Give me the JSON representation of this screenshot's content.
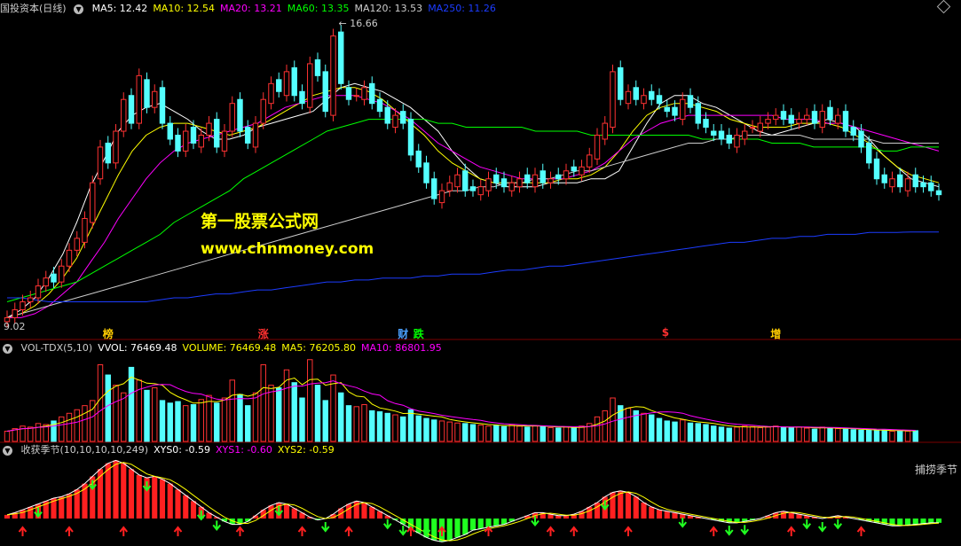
{
  "header": {
    "stock_name": "国投资本(日线)",
    "ma_labels": [
      {
        "text": "MA5: 12.42",
        "color": "#ffffff"
      },
      {
        "text": "MA10: 12.54",
        "color": "#ffff00"
      },
      {
        "text": "MA20: 13.21",
        "color": "#ff00ff"
      },
      {
        "text": "MA60: 13.35",
        "color": "#00ff00"
      },
      {
        "text": "MA120: 13.53",
        "color": "#cccccc"
      },
      {
        "text": "MA250: 11.26",
        "color": "#1c3cff"
      }
    ]
  },
  "vol_header": {
    "labels": [
      {
        "text": "VOL-TDX(5,10)",
        "color": "#cccccc"
      },
      {
        "text": "VVOL: 76469.48",
        "color": "#ffffff"
      },
      {
        "text": "VOLUME: 76469.48",
        "color": "#ffff00"
      },
      {
        "text": "MA5: 76205.80",
        "color": "#ffff00"
      },
      {
        "text": "MA10: 86801.95",
        "color": "#ff00ff"
      }
    ]
  },
  "ind_header": {
    "labels": [
      {
        "text": "收获季节(10,10,10,10,249)",
        "color": "#cccccc"
      },
      {
        "text": "XYS0: -0.59",
        "color": "#ffffff"
      },
      {
        "text": "XYS1: -0.60",
        "color": "#ff00ff"
      },
      {
        "text": "XYS2: -0.59",
        "color": "#ffff00"
      }
    ],
    "right_label": "捕捞季节"
  },
  "watermark": {
    "line1": "第一股票公式网",
    "line2": "www.chnmoney.com"
  },
  "events": [
    {
      "text": "榜",
      "color": "#ffcc00",
      "bar": 13
    },
    {
      "text": "涨",
      "color": "#ff3030",
      "bar": 33
    },
    {
      "text": "财",
      "color": "#4aa0ff",
      "bar": 51
    },
    {
      "text": "跌",
      "color": "#00ff00",
      "bar": 53
    },
    {
      "text": "$",
      "color": "#ff3030",
      "bar": 85
    },
    {
      "text": "增",
      "color": "#ffcc00",
      "bar": 99
    }
  ],
  "chart_data": {
    "type": "candlestick",
    "price_ylim": [
      9.02,
      16.66
    ],
    "price_high_label": "16.66",
    "price_low_label": "9.02",
    "closes": [
      9.1,
      9.3,
      9.5,
      9.6,
      9.9,
      10.1,
      10.0,
      10.4,
      10.8,
      11.1,
      11.6,
      12.5,
      13.4,
      13.0,
      13.8,
      14.6,
      14.0,
      15.2,
      14.4,
      14.8,
      14.0,
      13.6,
      13.3,
      13.8,
      13.5,
      13.7,
      14.0,
      13.4,
      13.8,
      14.5,
      13.8,
      13.5,
      14.0,
      14.6,
      15.0,
      14.8,
      15.3,
      14.7,
      14.5,
      15.5,
      15.2,
      14.3,
      16.2,
      15.0,
      14.6,
      14.7,
      14.9,
      14.5,
      14.3,
      14.0,
      14.2,
      14.0,
      13.2,
      12.9,
      12.5,
      12.1,
      12.3,
      12.5,
      12.7,
      12.3,
      12.3,
      12.4,
      12.6,
      12.5,
      12.4,
      12.5,
      12.6,
      12.5,
      12.7,
      12.5,
      12.6,
      12.6,
      12.8,
      12.8,
      12.9,
      13.2,
      13.7,
      14.0,
      15.3,
      14.6,
      14.8,
      14.6,
      14.7,
      14.6,
      14.5,
      14.3,
      14.2,
      14.6,
      14.4,
      14.0,
      13.9,
      13.7,
      13.6,
      13.5,
      13.7,
      13.8,
      13.9,
      14.0,
      14.1,
      14.2,
      14.1,
      14.0,
      14.1,
      14.2,
      14.0,
      14.3,
      14.1,
      14.2,
      13.8,
      13.7,
      13.4,
      13.0,
      12.6,
      12.5,
      12.6,
      12.4,
      12.6,
      12.4,
      12.4,
      12.3,
      12.2
    ],
    "opens": [
      9.0,
      9.1,
      9.3,
      9.5,
      9.6,
      9.9,
      10.2,
      10.0,
      10.4,
      10.8,
      11.0,
      11.5,
      12.6,
      13.5,
      13.0,
      13.8,
      14.7,
      14.0,
      15.1,
      14.4,
      14.9,
      14.0,
      13.7,
      13.3,
      13.9,
      13.4,
      13.7,
      14.1,
      13.3,
      13.8,
      14.6,
      13.9,
      13.4,
      14.0,
      14.5,
      15.1,
      14.7,
      15.4,
      14.8,
      14.4,
      15.6,
      15.3,
      14.2,
      16.3,
      14.9,
      14.7,
      14.6,
      15.0,
      14.6,
      14.4,
      13.9,
      14.3,
      14.1,
      13.3,
      13.0,
      12.6,
      12.0,
      12.3,
      12.4,
      12.8,
      12.4,
      12.2,
      12.3,
      12.7,
      12.6,
      12.3,
      12.4,
      12.7,
      12.4,
      12.8,
      12.5,
      12.7,
      12.6,
      12.9,
      12.7,
      12.9,
      13.1,
      13.6,
      13.9,
      15.4,
      14.5,
      14.9,
      14.5,
      14.8,
      14.7,
      14.4,
      14.4,
      14.1,
      14.7,
      14.5,
      14.1,
      13.8,
      13.8,
      13.7,
      13.4,
      13.6,
      13.9,
      13.8,
      14.0,
      14.1,
      14.3,
      14.2,
      14.0,
      14.1,
      14.3,
      13.9,
      14.4,
      14.0,
      14.3,
      13.9,
      13.8,
      13.5,
      13.1,
      12.7,
      12.4,
      12.7,
      12.3,
      12.7,
      12.5,
      12.5,
      12.3
    ],
    "ma_series": [
      {
        "name": "MA5",
        "color": "#ffffff",
        "values": [
          9.1,
          9.3,
          9.6,
          10.1,
          10.7,
          11.5,
          12.4,
          13.1,
          13.8,
          14.2,
          14.4,
          14.5,
          14.3,
          14.1,
          13.8,
          13.6,
          13.6,
          13.7,
          13.9,
          14.0,
          14.1,
          14.2,
          14.3,
          14.6,
          14.9,
          15.0,
          14.9,
          14.8,
          14.6,
          14.4,
          14.1,
          13.8,
          13.3,
          12.9,
          12.6,
          12.5,
          12.4,
          12.4,
          12.4,
          12.5,
          12.5,
          12.5,
          12.6,
          12.6,
          12.8,
          13.4,
          14.0,
          14.5,
          14.7,
          14.7,
          14.5,
          14.4,
          14.2,
          14.0,
          13.8,
          13.7,
          13.8,
          13.9,
          14.0,
          14.1,
          14.0,
          13.9,
          13.6,
          13.2,
          12.9,
          12.6,
          12.5,
          12.4
        ]
      },
      {
        "name": "MA10",
        "color": "#ffff00",
        "values": [
          9.1,
          9.2,
          9.4,
          9.7,
          10.1,
          10.6,
          11.3,
          12.0,
          12.7,
          13.3,
          13.7,
          13.9,
          14.0,
          14.0,
          13.9,
          13.8,
          13.7,
          13.8,
          13.9,
          14.1,
          14.3,
          14.5,
          14.7,
          14.8,
          14.9,
          14.9,
          14.8,
          14.6,
          14.3,
          14.0,
          13.7,
          13.3,
          13.0,
          12.8,
          12.6,
          12.5,
          12.5,
          12.5,
          12.5,
          12.5,
          12.6,
          12.6,
          12.7,
          12.9,
          13.3,
          13.8,
          14.2,
          14.4,
          14.5,
          14.5,
          14.4,
          14.3,
          14.1,
          14.0,
          13.9,
          13.9,
          13.9,
          14.0,
          14.0,
          14.0,
          13.9,
          13.7,
          13.5,
          13.2,
          12.9,
          12.7,
          12.6,
          12.5
        ]
      },
      {
        "name": "MA20",
        "color": "#ff00ff",
        "values": [
          9.1,
          9.1,
          9.2,
          9.4,
          9.7,
          10.0,
          10.5,
          11.0,
          11.6,
          12.1,
          12.6,
          13.0,
          13.3,
          13.5,
          13.6,
          13.7,
          13.8,
          13.9,
          14.0,
          14.2,
          14.4,
          14.5,
          14.6,
          14.7,
          14.7,
          14.7,
          14.6,
          14.5,
          14.3,
          14.1,
          13.8,
          13.5,
          13.3,
          13.1,
          12.9,
          12.8,
          12.7,
          12.6,
          12.6,
          12.6,
          12.6,
          12.7,
          12.8,
          13.0,
          13.3,
          13.6,
          13.8,
          14.0,
          14.1,
          14.2,
          14.2,
          14.2,
          14.2,
          14.2,
          14.2,
          14.2,
          14.1,
          14.1,
          14.1,
          14.0,
          14.0,
          13.9,
          13.8,
          13.7,
          13.6,
          13.5,
          13.4,
          13.3
        ]
      },
      {
        "name": "MA60",
        "color": "#00ff00",
        "values": [
          9.5,
          9.6,
          9.7,
          9.8,
          9.9,
          10.0,
          10.2,
          10.4,
          10.6,
          10.8,
          11.0,
          11.2,
          11.5,
          11.7,
          11.9,
          12.1,
          12.3,
          12.6,
          12.8,
          13.0,
          13.2,
          13.4,
          13.6,
          13.8,
          13.9,
          14.0,
          14.1,
          14.1,
          14.1,
          14.1,
          14.1,
          14.0,
          14.0,
          13.9,
          13.9,
          13.9,
          13.9,
          13.9,
          13.8,
          13.8,
          13.8,
          13.8,
          13.7,
          13.7,
          13.7,
          13.7,
          13.7,
          13.7,
          13.7,
          13.7,
          13.6,
          13.6,
          13.6,
          13.6,
          13.6,
          13.5,
          13.5,
          13.5,
          13.4,
          13.4,
          13.4,
          13.4,
          13.4,
          13.3,
          13.3,
          13.4,
          13.4,
          13.4
        ]
      },
      {
        "name": "MA120",
        "color": "#cccccc",
        "values": [
          9.1,
          9.2,
          9.3,
          9.4,
          9.5,
          9.6,
          9.7,
          9.8,
          9.9,
          10.0,
          10.1,
          10.2,
          10.3,
          10.4,
          10.5,
          10.6,
          10.7,
          10.8,
          10.9,
          11.0,
          11.1,
          11.2,
          11.3,
          11.4,
          11.5,
          11.6,
          11.7,
          11.8,
          11.9,
          12.0,
          12.1,
          12.2,
          12.3,
          12.3,
          12.4,
          12.4,
          12.5,
          12.5,
          12.6,
          12.6,
          12.7,
          12.8,
          12.8,
          12.9,
          13.0,
          13.1,
          13.2,
          13.3,
          13.4,
          13.5,
          13.5,
          13.6,
          13.6,
          13.7,
          13.7,
          13.7,
          13.7,
          13.7,
          13.6,
          13.6,
          13.6,
          13.6,
          13.6,
          13.5,
          13.5,
          13.5,
          13.5,
          13.5
        ]
      },
      {
        "name": "MA250",
        "color": "#1c3cff",
        "values": [
          9.6,
          9.6,
          9.55,
          9.5,
          9.5,
          9.5,
          9.5,
          9.5,
          9.5,
          9.5,
          9.5,
          9.55,
          9.6,
          9.6,
          9.65,
          9.7,
          9.7,
          9.75,
          9.8,
          9.8,
          9.85,
          9.9,
          9.95,
          10.0,
          10.0,
          10.05,
          10.05,
          10.1,
          10.1,
          10.1,
          10.15,
          10.15,
          10.2,
          10.2,
          10.2,
          10.25,
          10.3,
          10.3,
          10.35,
          10.4,
          10.4,
          10.45,
          10.5,
          10.55,
          10.6,
          10.65,
          10.7,
          10.75,
          10.8,
          10.85,
          10.9,
          10.95,
          11.0,
          11.0,
          11.05,
          11.1,
          11.1,
          11.15,
          11.15,
          11.2,
          11.2,
          11.2,
          11.25,
          11.25,
          11.25,
          11.26,
          11.26,
          11.26
        ]
      }
    ],
    "volume_ylim": [
      0,
      170000
    ],
    "volumes": [
      20000,
      25000,
      30000,
      28000,
      35000,
      33000,
      40000,
      48000,
      55000,
      62000,
      70000,
      80000,
      150000,
      130000,
      110000,
      95000,
      145000,
      120000,
      100000,
      105000,
      80000,
      75000,
      78000,
      70000,
      72000,
      82000,
      90000,
      75000,
      85000,
      120000,
      92000,
      70000,
      95000,
      150000,
      110000,
      105000,
      140000,
      115000,
      85000,
      160000,
      110000,
      80000,
      130000,
      95000,
      70000,
      68000,
      72000,
      60000,
      58000,
      55000,
      52000,
      48000,
      62000,
      50000,
      45000,
      42000,
      40000,
      38000,
      36000,
      35000,
      33000,
      32000,
      30000,
      31000,
      29000,
      33000,
      30000,
      28000,
      31000,
      29000,
      27000,
      26000,
      28000,
      27000,
      30000,
      35000,
      48000,
      60000,
      85000,
      70000,
      65000,
      60000,
      55000,
      52000,
      45000,
      40000,
      38000,
      42000,
      36000,
      35000,
      33000,
      30000,
      28000,
      26000,
      28000,
      30000,
      29000,
      27000,
      28000,
      30000,
      28000,
      27000,
      28000,
      26000,
      24000,
      28000,
      26000,
      25000,
      24000,
      23000,
      22000,
      22000,
      21000,
      22000,
      20000,
      21000,
      20000,
      21000
    ],
    "xys0": [
      0.5,
      0.8,
      1.2,
      1.6,
      2.0,
      2.4,
      2.8,
      3.0,
      3.4,
      4.0,
      4.8,
      5.8,
      6.8,
      7.6,
      8.0,
      7.6,
      6.8,
      6.0,
      5.6,
      5.8,
      5.4,
      4.8,
      4.0,
      3.2,
      2.4,
      1.6,
      0.8,
      0.2,
      -0.4,
      -0.8,
      -0.8,
      -0.4,
      0.4,
      1.2,
      1.8,
      2.2,
      2.0,
      1.4,
      0.8,
      0.2,
      -0.2,
      0.0,
      0.6,
      1.4,
      2.0,
      2.4,
      2.2,
      1.6,
      1.0,
      0.4,
      -0.2,
      -0.8,
      -1.4,
      -2.0,
      -2.6,
      -3.0,
      -3.2,
      -3.0,
      -2.6,
      -2.2,
      -1.6,
      -1.4,
      -1.2,
      -1.0,
      -0.8,
      -0.4,
      0.0,
      0.4,
      0.8,
      0.8,
      0.6,
      0.4,
      0.4,
      0.6,
      1.0,
      1.6,
      2.2,
      3.0,
      3.6,
      3.8,
      3.6,
      3.0,
      2.2,
      1.6,
      1.2,
      1.0,
      0.8,
      0.6,
      0.4,
      0.2,
      0.0,
      -0.2,
      -0.4,
      -0.6,
      -0.6,
      -0.4,
      -0.2,
      0.0,
      0.4,
      0.8,
      1.0,
      0.8,
      0.6,
      0.4,
      0.2,
      0.0,
      0.2,
      0.4,
      0.2,
      0.0,
      -0.2,
      -0.4,
      -0.6,
      -0.8,
      -1.0,
      -1.0,
      -0.9,
      -0.8,
      -0.7,
      -0.6,
      -0.59
    ],
    "buy_signals": [
      2,
      8,
      15,
      22,
      30,
      38,
      44,
      52,
      56,
      62,
      70,
      73,
      80,
      91,
      101,
      110
    ],
    "sell_signals": [
      4,
      11,
      18,
      25,
      27,
      35,
      41,
      49,
      51,
      54,
      68,
      77,
      87,
      93,
      95,
      103,
      105,
      107
    ]
  }
}
